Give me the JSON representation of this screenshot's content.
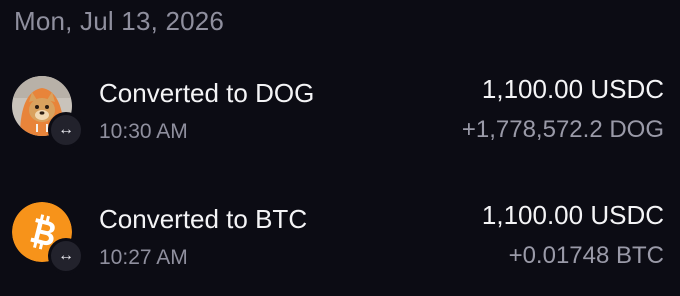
{
  "date_header": "Mon, Jul 13, 2026",
  "transactions": [
    {
      "title": "Converted to DOG",
      "time": "10:30 AM",
      "amount": "1,100.00 USDC",
      "received": "+1,778,572.2 DOG",
      "avatar_icon": "dog-token-icon",
      "badge_glyph": "↔"
    },
    {
      "title": "Converted to BTC",
      "time": "10:27 AM",
      "amount": "1,100.00 USDC",
      "received": "+0.01748 BTC",
      "avatar_icon": "bitcoin-icon",
      "badge_glyph": "↔"
    }
  ],
  "colors": {
    "background": "#0c0c14",
    "primary_text": "#f4f4f6",
    "secondary_text": "#8f8f9e",
    "bitcoin_orange": "#f7931a"
  }
}
